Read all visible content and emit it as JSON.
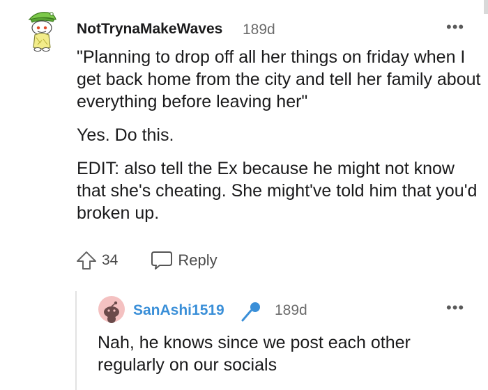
{
  "comment": {
    "username": "NotTrynaMakeWaves",
    "age": "189d",
    "more_label": "•••",
    "paragraphs": [
      "\"Planning to drop off all her things on friday when I get back home from the city and tell her family about everything before leaving her\"",
      "Yes. Do this.",
      "EDIT: also tell the Ex because he might not know that she's cheating. She might've told him that you'd broken up."
    ],
    "vote_count": "34",
    "reply_label": "Reply",
    "upvote_icon": "upvote-arrow-icon",
    "reply_icon": "speech-bubble-icon"
  },
  "reply": {
    "username": "SanAshi1519",
    "age": "189d",
    "more_label": "•••",
    "body": "Nah, he knows since we post each other regularly on our socials",
    "badge_icon": "microphone-icon",
    "username_color": "#3a8fd8",
    "avatar_color": "#f2b3b3"
  }
}
